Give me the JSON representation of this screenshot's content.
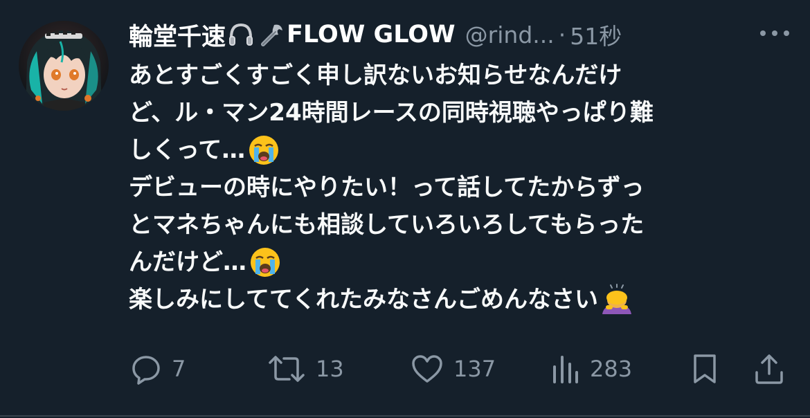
{
  "tweet": {
    "display_name": "輪堂千速",
    "name_suffix": "FLOW GLOW",
    "name_emojis": [
      "headphones-icon",
      "wrench-icon"
    ],
    "handle": "@rind...",
    "separator": "·",
    "time": "51秒",
    "lines": [
      "あとすごくすごく申し訳ないお知らせなんだけ",
      "ど、ル・マン24時間レースの同時視聴やっぱり難",
      "しくって…",
      "デビューの時にやりたい！って話してたからずっ",
      "とマネちゃんにも相談していろいろしてもらった",
      "んだけど…",
      "楽しみにしててくれたみなさんごめんなさい"
    ],
    "line_emojis": {
      "2": "loudly-crying-face-icon",
      "5": "loudly-crying-face-icon",
      "6": "person-bowing-icon"
    }
  },
  "actions": {
    "reply_count": "7",
    "retweet_count": "13",
    "like_count": "137",
    "views_count": "283"
  },
  "colors": {
    "background": "#15202b",
    "text": "#f7f9f9",
    "secondary": "#8b98a5"
  }
}
